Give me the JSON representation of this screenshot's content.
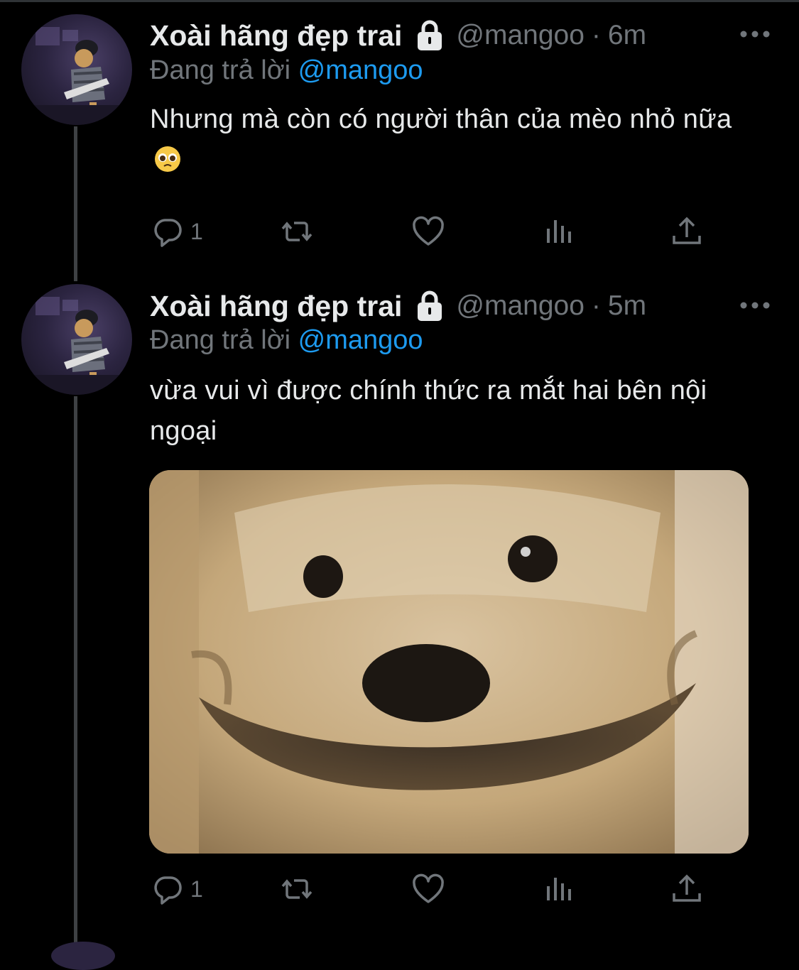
{
  "tweets": [
    {
      "author": "Xoài hãng đẹp trai",
      "handle": "@mangoo",
      "separator": "·",
      "time": "6m",
      "reply_prefix": "Đang trả lời",
      "reply_to": "@mangoo",
      "text": "Nhưng mà còn có người thân của mèo nhỏ nữa",
      "emoji": "pleading-face",
      "reply_count": "1"
    },
    {
      "author": "Xoài hãng đẹp trai",
      "handle": "@mangoo",
      "separator": "·",
      "time": "5m",
      "reply_prefix": "Đang trả lời",
      "reply_to": "@mangoo",
      "text": "vừa vui vì được chính thức ra mắt hai bên nội ngoại",
      "media": "dog-smiling-photo",
      "reply_count": "1"
    }
  ],
  "icons": [
    "lock-icon",
    "more-icon",
    "reply-icon",
    "retweet-icon",
    "like-icon",
    "analytics-icon",
    "share-icon"
  ],
  "colors": {
    "background": "#000000",
    "text_primary": "#e7e9ea",
    "text_secondary": "#71767b",
    "mention": "#1d9bf0",
    "thread_line": "#3e4144"
  }
}
